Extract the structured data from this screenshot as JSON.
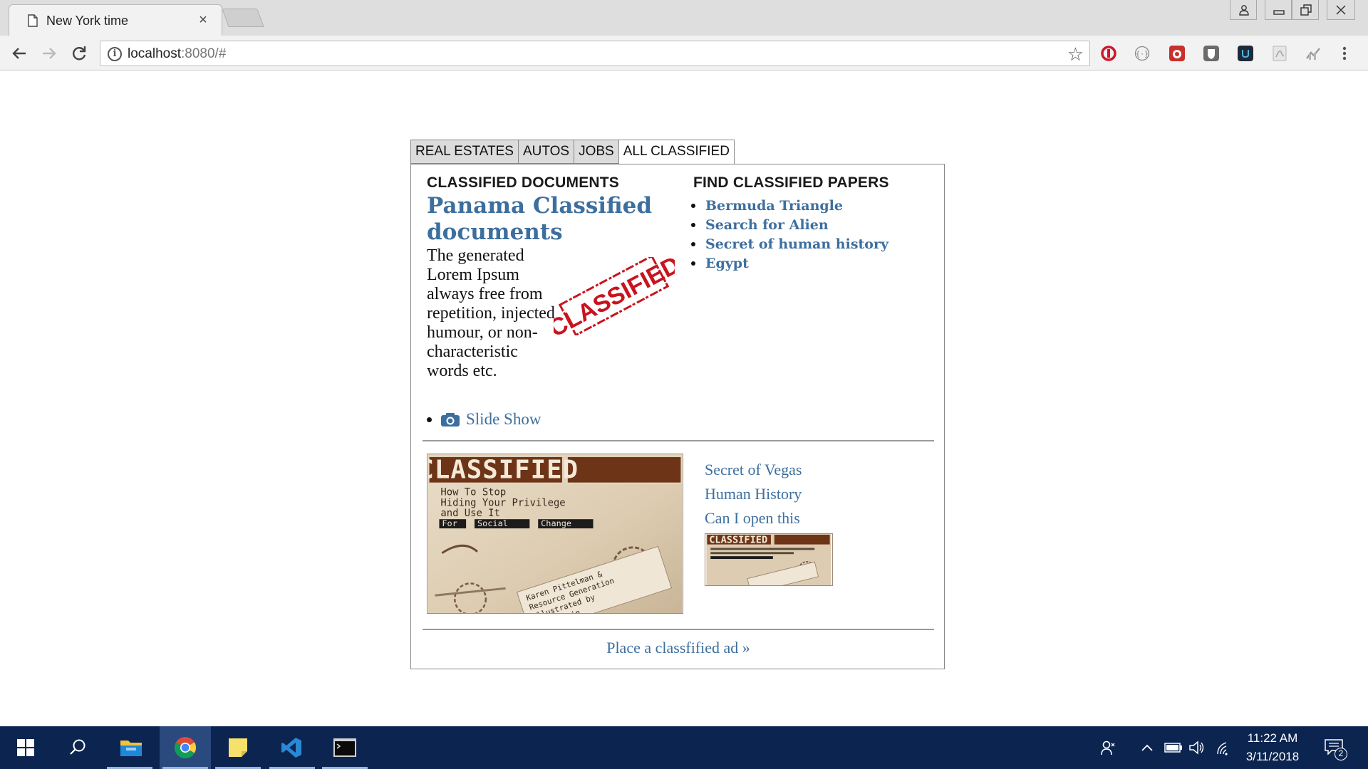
{
  "browser": {
    "tab_title": "New York time",
    "tab_close": "×",
    "url_host": "localhost",
    "url_rest": ":8080/#",
    "info_glyph": "i",
    "star_glyph": "☆",
    "extensions": [
      "opera-icon",
      "code-braces-icon",
      "ladybug-icon",
      "shield-icon",
      "u-icon",
      "pdf-icon",
      "chart-icon",
      "menu-dots-icon"
    ]
  },
  "tabs": [
    {
      "label": "REAL ESTATES",
      "active": false
    },
    {
      "label": "AUTOS",
      "active": false
    },
    {
      "label": "JOBS",
      "active": false
    },
    {
      "label": "ALL CLASSIFIED",
      "active": true
    }
  ],
  "documents": {
    "heading": "CLASSIFIED DOCUMENTS",
    "feature_title": "Panama Classified documents",
    "feature_body": "The generated Lorem Ipsum always free from repetition, injected humour, or non-characteristic words etc.",
    "stamp_text": "CLASSIFIED",
    "slideshow_label": "Slide Show"
  },
  "find_papers": {
    "heading": "FIND CLASSIFIED PAPERS",
    "links": [
      "Bermuda Triangle",
      "Search for Alien",
      "Secret of human history",
      "Egypt"
    ]
  },
  "book": {
    "title_text": "CLASSIFIED",
    "subtitle_lines": [
      "How To Stop",
      "Hiding Your Privilege",
      "and Use It"
    ],
    "highlight_words": [
      "For",
      "Social",
      "Change"
    ],
    "authors_lines": [
      "Karen Pittelman &",
      "Resource Generation",
      "Illustrated by",
      "Molly Hein"
    ]
  },
  "side_links": [
    "Secret of Vegas",
    "Human History",
    "Can I open this"
  ],
  "place_ad": "Place a classfified ad »",
  "taskbar": {
    "time": "11:22 AM",
    "date": "3/11/2018",
    "notification_count": "2"
  },
  "colors": {
    "link": "#3d6f9e",
    "stamp": "#c8141e",
    "taskbar": "#0c2450"
  }
}
